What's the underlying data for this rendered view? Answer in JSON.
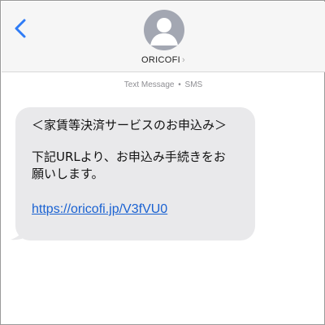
{
  "header": {
    "back_icon": "chevron-left-icon",
    "avatar_icon": "person-silhouette-icon",
    "contact_name": "ORICOFI",
    "contact_chevron": "›"
  },
  "thread": {
    "service_type": "Text Message",
    "separator": "•",
    "service_name": "SMS"
  },
  "message": {
    "line1": "＜家賃等決済サービスのお申込み＞",
    "line2": "下記URLより、お申込み手続きをお",
    "line3": "願いします。",
    "link": "https://oricofi.jp/V3fVU0",
    "bubble_color": "#e9e9eb",
    "link_color": "#1a62d2"
  },
  "colors": {
    "accent": "#2f7cf6",
    "header_bg": "#f6f6f6",
    "avatar_bg": "#a3a7b2"
  }
}
